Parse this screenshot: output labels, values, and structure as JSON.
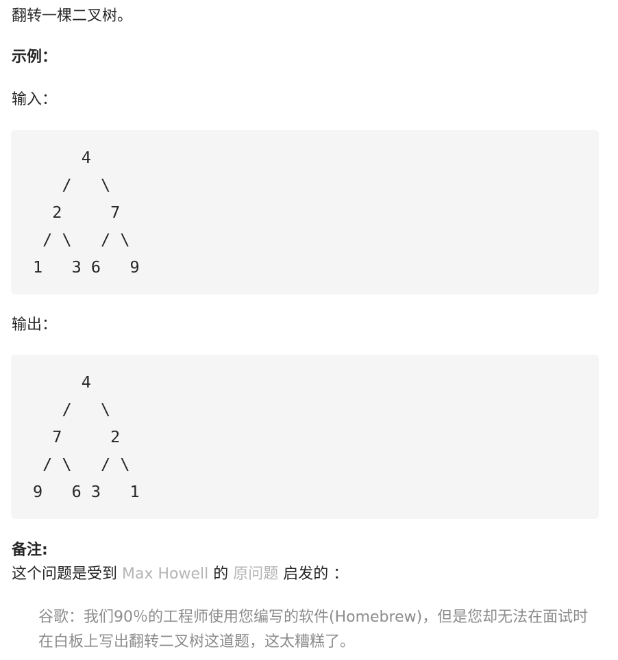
{
  "problem": {
    "intro": "翻转一棵二叉树。",
    "example_heading": "示例：",
    "input_label": "输入：",
    "input_tree": "     4\n   /   \\\n  2     7\n / \\   / \\\n1   3 6   9",
    "output_label": "输出：",
    "output_tree": "     4\n   /   \\\n  7     2\n / \\   / \\\n9   6 3   1"
  },
  "note": {
    "heading": "备注:",
    "prefix": "这个问题是受到 ",
    "author_link": "Max Howell",
    "middle": " 的 ",
    "original_link": "原问题",
    "suffix": " 启发的 ：",
    "quote": "谷歌：我们90％的工程师使用您编写的软件(Homebrew)，但是您却无法在面试时在白板上写出翻转二叉树这道题，这太糟糕了。"
  },
  "colors": {
    "text": "#262626",
    "link": "#b5b5b5",
    "quote": "#8c8c8c",
    "code_background": "#f5f5f5"
  }
}
